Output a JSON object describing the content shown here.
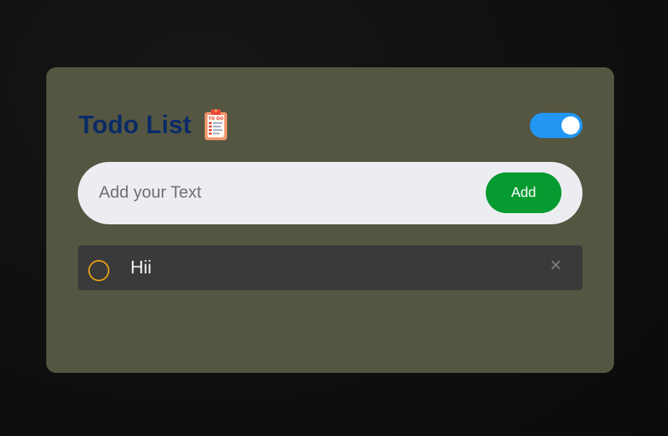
{
  "app": {
    "title": "Todo List",
    "title_icon": "clipboard-todo-icon",
    "title_icon_label": "TO DO",
    "theme_toggle": {
      "state": "on",
      "color": "#2196f3"
    }
  },
  "input": {
    "placeholder": "Add your Text",
    "value": ""
  },
  "add_button": {
    "label": "Add",
    "color": "#069b30"
  },
  "todos": [
    {
      "text": "Hii",
      "completed": false,
      "check_icon": "circle-outline-icon",
      "delete_icon": "close-icon",
      "delete_glyph": "✕"
    }
  ],
  "colors": {
    "background": "#111111",
    "card": "#545642",
    "title": "#0b2a66",
    "input_bg": "#ebedf0",
    "item_bg": "#3a3a3a",
    "check_circle": "#f2a312"
  }
}
